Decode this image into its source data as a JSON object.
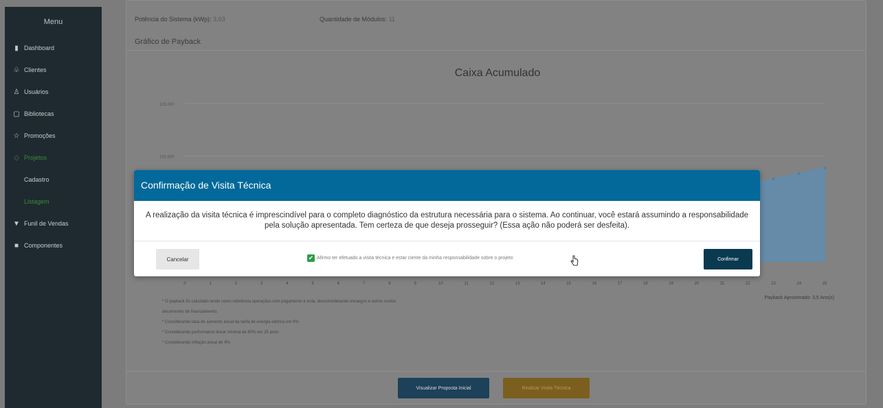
{
  "sidebar": {
    "title": "Menu",
    "items": [
      {
        "icon": "bar-chart-icon",
        "glyph": "▮",
        "label": "Dashboard"
      },
      {
        "icon": "users-icon",
        "glyph": "♧",
        "label": "Clientes"
      },
      {
        "icon": "user-icon",
        "glyph": "♙",
        "label": "Usuários"
      },
      {
        "icon": "book-icon",
        "glyph": "▢",
        "label": "Bibliotecas"
      },
      {
        "icon": "star-icon",
        "glyph": "☆",
        "label": "Promoções"
      },
      {
        "icon": "project-icon",
        "glyph": "◇",
        "label": "Projetos"
      },
      {
        "label": "Cadastro"
      },
      {
        "label": "Listagem"
      },
      {
        "icon": "funnel-icon",
        "glyph": "▼",
        "label": "Funil de Vendas"
      },
      {
        "icon": "box-icon",
        "glyph": "■",
        "label": "Componentes"
      }
    ]
  },
  "info": {
    "power_label": "Potência do Sistema (kWp):",
    "power_value": "3,63",
    "modules_label": "Quantidade de Módulos:",
    "modules_value": "11"
  },
  "section_title": "Gráfico de Payback",
  "chart_data": {
    "type": "area",
    "title": "Caixa Acumulado",
    "x": [
      0,
      1,
      2,
      3,
      4,
      5,
      6,
      7,
      8,
      9,
      10,
      11,
      12,
      13,
      14,
      15,
      16,
      17,
      18,
      19,
      20,
      21,
      22,
      23,
      24,
      25
    ],
    "series": [
      {
        "values": [
          -12000,
          -8500,
          -5000,
          -1500,
          2000,
          6000,
          10000,
          14500,
          19000,
          24000,
          29000,
          34500,
          40000,
          46000,
          52000,
          58500,
          65000,
          72000,
          79000,
          86000,
          93500,
          101000,
          109000,
          117000,
          125000,
          133000
        ]
      }
    ],
    "y_ticks": [
      "225.000",
      "150.000"
    ],
    "ylim": [
      -20000,
      225000
    ],
    "grid": true,
    "color": "#5b8eb5"
  },
  "notes": [
    "* O payback foi calculado tendo como referência operações com pagamento à vista, desconsiderando encargos e outros custos",
    "decorrentes de financiamento.",
    "* Considerando taxa de aumento anual da tarifa de energia elétrica em 9%",
    "* Considerando performance linear mínima de 80% em 25 anos",
    "* Considerando inflação anual de 4%"
  ],
  "payback": "Payback Aproximado: 3,5 Ano(s)",
  "buttons": {
    "view": "Visualizar Proposta Inicial",
    "visit": "Realizar Visita Técnica"
  },
  "modal": {
    "title": "Confirmação de Visita Técnica",
    "body": "A realização da visita técnica é imprescindível para o completo diagnóstico da estrutura necessária para o sistema. Ao continuar, você estará assumindo a responsabilidade pela solução apresentada. Tem certeza de que deseja prosseguir? (Essa ação não poderá ser desfeita).",
    "cancel": "Cancelar",
    "checkbox_label": "Afirmo ter efetuado a visita técnica e estar ciente da minha responsabilidade sobre o projeto",
    "checkbox_checked": true,
    "confirm": "Confirmar"
  }
}
